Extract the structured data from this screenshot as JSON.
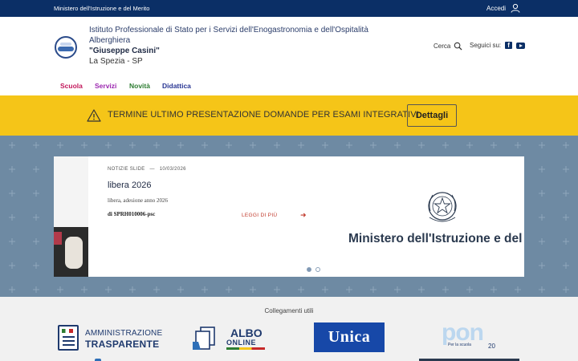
{
  "topbar": {
    "ministry": "Ministero dell'Istruzione e del Merito",
    "login_label": "Accedi"
  },
  "header": {
    "school_line1": "Istituto Professionale di Stato per i Servizi dell'Enogastronomia e dell'Ospitalità Alberghiera",
    "school_name": "\"Giuseppe Casini\"",
    "city": "La Spezia - SP",
    "search_label": "Cerca",
    "social_label": "Seguici su:"
  },
  "nav": {
    "items": [
      "Scuola",
      "Servizi",
      "Novità",
      "Didattica"
    ]
  },
  "alert": {
    "message": "TERMINE ULTIMO PRESENTAZIONE DOMANDE PER ESAMI INTEGRATIVI",
    "button_label": "Dettagli"
  },
  "slide": {
    "category": "NOTIZIE SLIDE",
    "separator": "—",
    "date": "10/03/2026",
    "title": "libera 2026",
    "description": "libera, adesione anno 2026",
    "author": "di SPRH010006-psc",
    "read_more": "LEGGI DI PIÙ",
    "image_caption": "Ministero dell'Istruzione e del Merito",
    "total_dots": 2,
    "active_dot": 1
  },
  "links": {
    "heading": "Collegamenti utili",
    "amministrazione": {
      "line1": "AMMINISTRAZIONE",
      "line2": "TRASPARENTE"
    },
    "albo": {
      "line1": "ALBO",
      "line2": "ONLINE"
    },
    "unica": "Unica",
    "pon": {
      "logo": "pon",
      "subtitle": "Per la scuola",
      "year": "20"
    }
  }
}
